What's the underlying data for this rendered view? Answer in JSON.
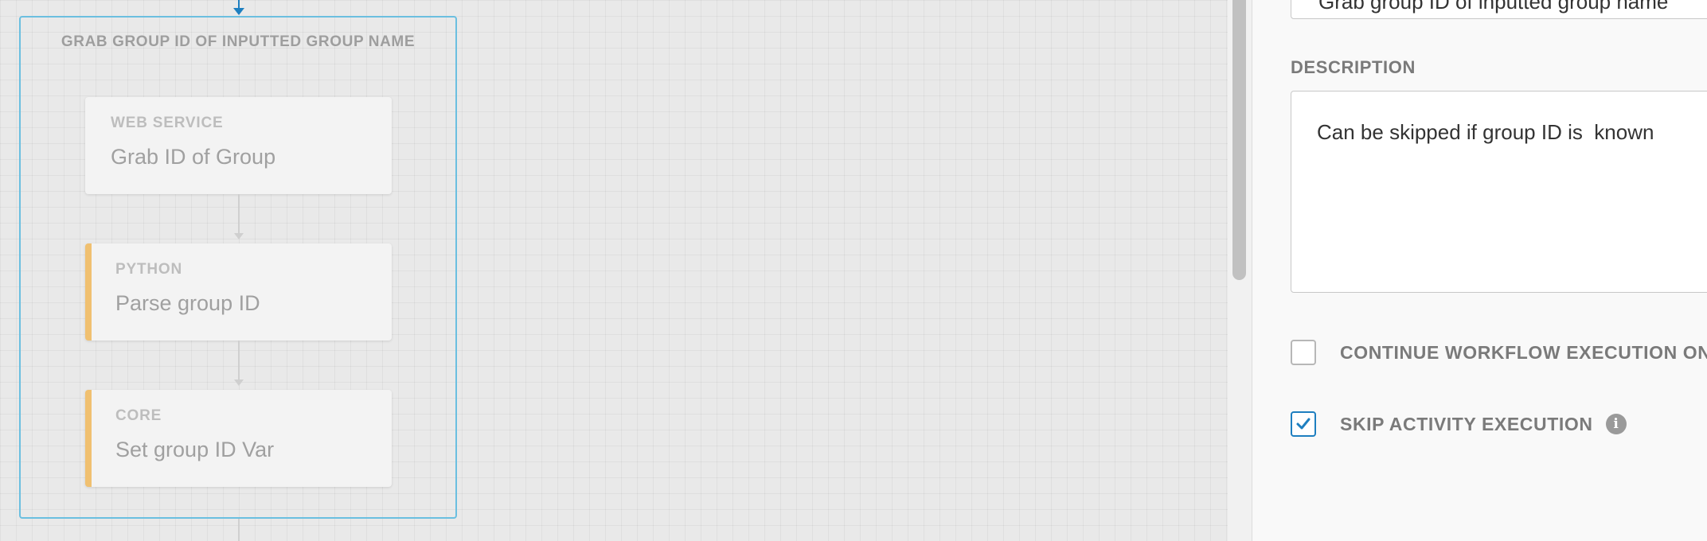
{
  "canvas": {
    "group": {
      "title": "GRAB GROUP ID OF INPUTTED GROUP NAME",
      "activities": [
        {
          "type": "WEB SERVICE",
          "name": "Grab ID of Group"
        },
        {
          "type": "PYTHON",
          "name": "Parse group ID"
        },
        {
          "type": "CORE",
          "name": "Set group ID Var"
        }
      ]
    }
  },
  "panel": {
    "name_value": "Grab group ID of inputted group name",
    "description_label": "DESCRIPTION",
    "description_value": "Can be skipped if group ID is  known",
    "continue_label": "CONTINUE WORKFLOW EXECUTION ON FAILURE",
    "continue_checked": false,
    "skip_label": "SKIP ACTIVITY EXECUTION",
    "skip_checked": true,
    "info_icon": "info-icon"
  },
  "colors": {
    "accent_blue": "#1e7fc0",
    "group_border": "#6bbfe0",
    "card_accent": "#f0c070"
  }
}
